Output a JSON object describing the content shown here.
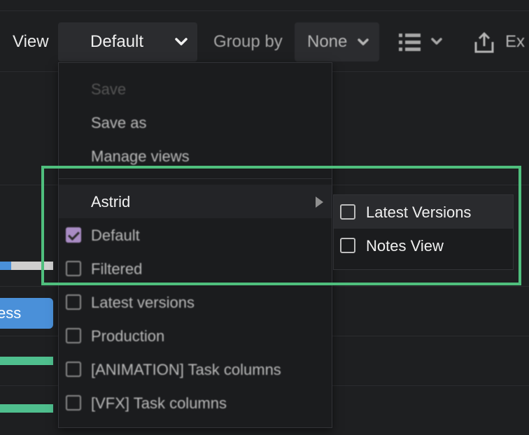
{
  "toolbar": {
    "view_label": "View",
    "view_value": "Default",
    "group_by_label": "Group by",
    "group_by_value": "None",
    "export_label": "Ex"
  },
  "background": {
    "status_label": "ess"
  },
  "view_menu": {
    "actions": [
      {
        "label": "Save",
        "enabled": false
      },
      {
        "label": "Save as",
        "enabled": true
      },
      {
        "label": "Manage views",
        "enabled": true
      }
    ],
    "user_group": {
      "label": "Astrid",
      "has_submenu": true
    },
    "views": [
      {
        "label": "Default",
        "checked": true
      },
      {
        "label": "Filtered",
        "checked": false
      },
      {
        "label": "Latest versions",
        "checked": false
      },
      {
        "label": "Production",
        "checked": false
      },
      {
        "label": "[ANIMATION] Task columns",
        "checked": false
      },
      {
        "label": "[VFX] Task columns",
        "checked": false
      }
    ]
  },
  "submenu": {
    "items": [
      {
        "label": "Latest Versions",
        "checked": false
      },
      {
        "label": "Notes View",
        "checked": false
      }
    ]
  },
  "colors": {
    "accent_purple": "#a98cc4",
    "highlight_green": "#4fbf7d",
    "status_blue": "#4a90d9",
    "progress_green": "#4fbf8e"
  }
}
